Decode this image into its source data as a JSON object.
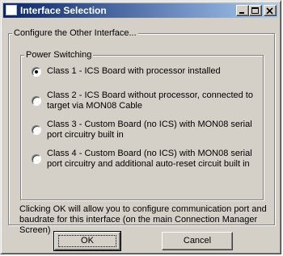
{
  "window": {
    "title": "Interface Selection"
  },
  "outer_group": {
    "legend": "Configure the Other Interface..."
  },
  "inner_group": {
    "legend": "Power Switching"
  },
  "options": [
    {
      "label": "Class 1 - ICS Board with processor installed",
      "selected": true
    },
    {
      "label": "Class 2 -  ICS Board without processor, connected to target via MON08 Cable",
      "selected": false
    },
    {
      "label": "Class 3 - Custom Board (no ICS) with MON08 serial port circuitry built in",
      "selected": false
    },
    {
      "label": "Class 4 - Custom Board (no ICS) with MON08 serial port circuitry and additional auto-reset circuit built in",
      "selected": false
    }
  ],
  "note": "Clicking OK will allow you to configure communication port and baudrate for this interface (on the main Connection Manager Screen)",
  "buttons": {
    "ok": "OK",
    "cancel": "Cancel"
  }
}
